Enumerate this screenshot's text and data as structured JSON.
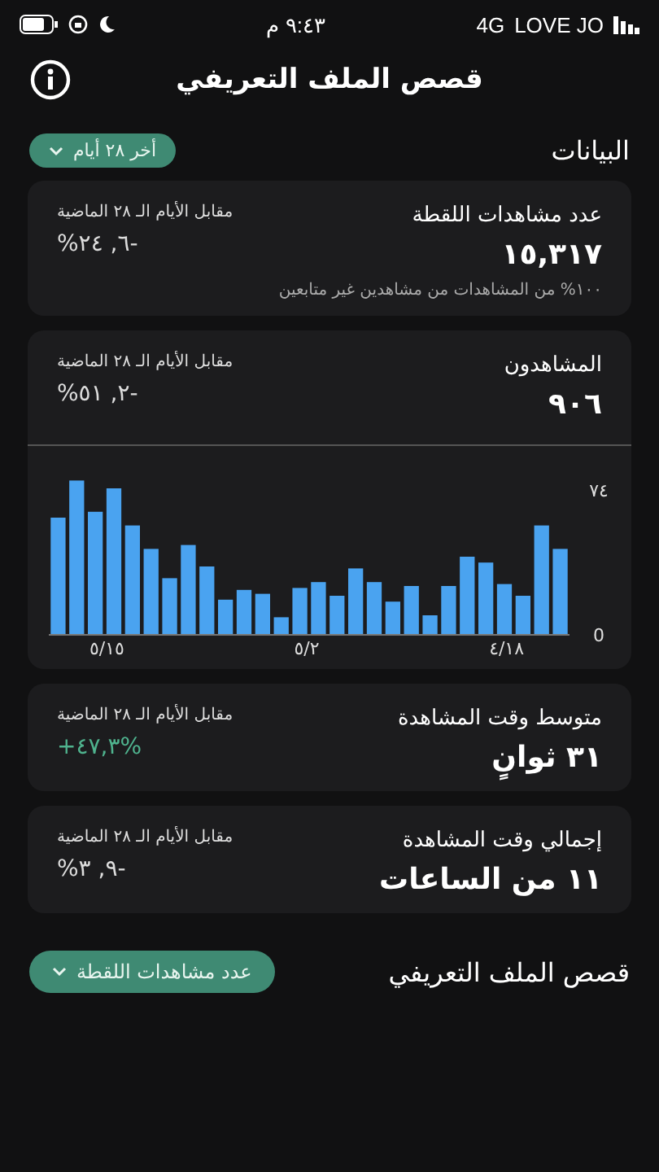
{
  "status_bar": {
    "time": "٩:٤٣ م",
    "network": "4G",
    "carrier": "LOVE JO"
  },
  "header": {
    "title": "قصص الملف التعريفي"
  },
  "section": {
    "title": "البيانات",
    "filter": "أخر ٢٨ أيام"
  },
  "cards": [
    {
      "kind": "stat",
      "title": "عدد مشاهدات اللقطة",
      "value": "١٥,٣١٧",
      "compare_label": "مقابل الأيام الـ ٢٨ الماضية",
      "change": "%٢٤ ,٦-",
      "color": "#dddddd",
      "note": "١٠٠% من المشاهدات من مشاهدين غير متابعين"
    },
    {
      "kind": "chart",
      "title": "المشاهدون",
      "value": "٩٠٦",
      "compare_label": "مقابل الأيام الـ ٢٨ الماضية",
      "change": "%٥١ ,٢-",
      "color": "#dddddd",
      "date_labels": [
        "٤/١٨",
        "٥/٢",
        "٥/١٥"
      ],
      "chart_data": {
        "type": "bar",
        "values": [
          60,
          79,
          63,
          75,
          56,
          44,
          29,
          46,
          35,
          18,
          23,
          21,
          9,
          24,
          27,
          20,
          34,
          27,
          17,
          25,
          10,
          25,
          40,
          37,
          26,
          20,
          56,
          44
        ],
        "ylim": [
          0,
          80
        ],
        "orientation": "vertical",
        "yticks": [
          {
            "value": 0,
            "label": "0"
          },
          {
            "value": 74,
            "label": "٧٤"
          }
        ]
      }
    },
    {
      "kind": "stat",
      "title": "متوسط وقت المشاهدة",
      "value": "٣١ ثوانٍ",
      "compare_label": "مقابل الأيام الـ ٢٨ الماضية",
      "change": "+٤٧,٣%",
      "color": "#4fb38e"
    },
    {
      "kind": "stat",
      "title": "إجمالي وقت المشاهدة",
      "value": "١١ من الساعات",
      "compare_label": "مقابل الأيام الـ ٢٨ الماضية",
      "change": "%٣ ,٩-",
      "color": "#dddddd"
    }
  ],
  "stories": {
    "title": "قصص الملف التعريفي",
    "filter": "عدد مشاهدات اللقطة"
  }
}
